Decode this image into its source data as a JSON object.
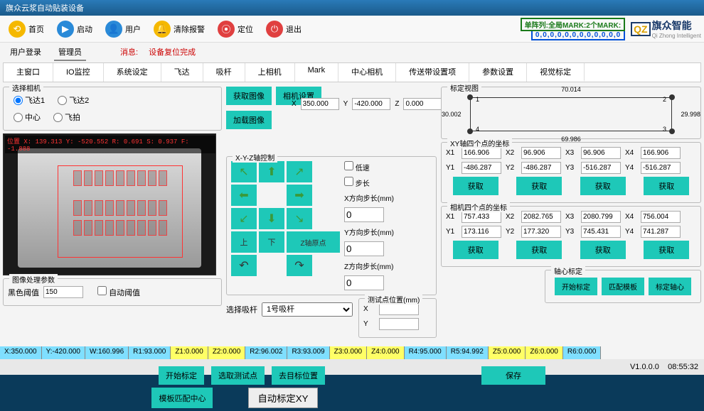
{
  "window_title": "旗众云浆自动贴装设备",
  "toolbar": {
    "home": "首页",
    "start": "启动",
    "user": "用户",
    "clear_alarm": "清除报警",
    "goto": "定位",
    "exit": "退出"
  },
  "status_line1": "单阵列:全局MARK:2个MARK:",
  "status_line2": "0,0,0,0,0,0,0,0,0,0,0,0",
  "brand": "旗众智能",
  "brand_sub": "Qi Zhong Intelligent",
  "tabs1": {
    "t1": "用户登录",
    "t2": "管理员",
    "msg_label": "消息:",
    "msg": "设备复位完成"
  },
  "tabs2": [
    "主窗口",
    "IO监控",
    "系统设定",
    "飞达",
    "吸杆",
    "上相机",
    "Mark",
    "中心相机",
    "传送带设置项",
    "参数设置",
    "视觉标定"
  ],
  "tabs2_active": 10,
  "cam_select": {
    "title": "选择相机",
    "o1": "飞达1",
    "o2": "飞达2",
    "o3": "中心",
    "o4": "飞拍"
  },
  "cam_btns": {
    "b1": "获取图像",
    "b2": "相机设置",
    "b3": "加载图像"
  },
  "cam_overlay": "位置 X: 139.313 Y: -520.552 R: 0.691 S: 0.937 F: -1.888",
  "xyz": {
    "xl": "X",
    "x": "350.000",
    "yl": "Y",
    "y": "-420.000",
    "zl": "Z",
    "z": "0.000"
  },
  "xyz_ctrl": {
    "title": "X-Y-Z轴控制",
    "low": "低速",
    "step": "步长",
    "xstep_l": "X方向步长(mm)",
    "xstep": "0",
    "ystep_l": "Y方向步长(mm)",
    "ystep": "0",
    "zstep_l": "Z方向步长(mm)",
    "zstep": "0",
    "up": "上",
    "down": "下",
    "zorigin": "Z轴原点"
  },
  "test_pt": {
    "title": "测试点位置(mm)",
    "xl": "X",
    "x": "",
    "yl": "Y",
    "y": ""
  },
  "img_proc": {
    "title": "图像处理参数",
    "thresh_l": "黑色阈值",
    "thresh": "150",
    "auto": "自动阈值"
  },
  "pick_head": {
    "label": "选择吸杆",
    "val": "1号吸杆"
  },
  "calib_show": {
    "title": "标定视图",
    "top": "70.014",
    "right": "29.998",
    "bottom": "69.986",
    "left": "30.002",
    "n1": "1",
    "n2": "2",
    "n3": "3",
    "n4": "4"
  },
  "xy4": {
    "title": "XY轴四个点的坐标",
    "x1": "166.906",
    "x2": "96.906",
    "x3": "96.906",
    "x4": "166.906",
    "y1": "-486.287",
    "y2": "-486.287",
    "y3": "-516.287",
    "y4": "-516.287",
    "btn": "获取"
  },
  "cam4": {
    "title": "相机四个点的坐标",
    "x1": "757.433",
    "x2": "2082.765",
    "x3": "2080.799",
    "x4": "756.004",
    "y1": "173.116",
    "y2": "177.320",
    "y3": "745.431",
    "y4": "741.287",
    "btn": "获取"
  },
  "axis_calib": {
    "title": "轴心标定",
    "b1": "开始标定",
    "b2": "匹配模板",
    "b3": "标定轴心"
  },
  "actions": {
    "start": "开始标定",
    "teach": "选取测试点",
    "goto": "去目标位置",
    "save": "保存",
    "match": "模板匹配中心",
    "autoxy": "自动标定XY"
  },
  "footer": {
    "x": "X:350.000",
    "y": "Y:-420.000",
    "w": "W:160.996",
    "r1": "R1:93.000",
    "z1": "Z1:0.000",
    "z2": "Z2:0.000",
    "r2": "R2:96.002",
    "r3": "R3:93.009",
    "z3": "Z3:0.000",
    "z4": "Z4:0.000",
    "r4": "R4:95.000",
    "r5": "R5:94.992",
    "z5": "Z5:0.000",
    "z6": "Z6:0.000",
    "r6": "R6:0.000"
  },
  "version": "V1.0.0.0",
  "clock": "08:55:32"
}
